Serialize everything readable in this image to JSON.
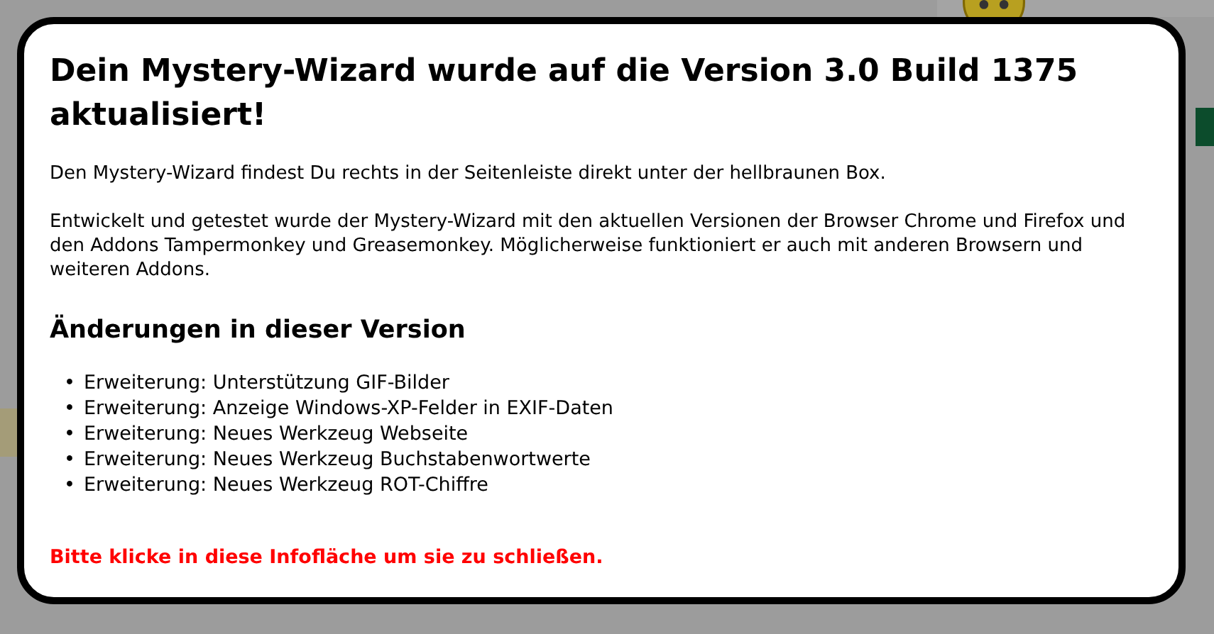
{
  "dialog": {
    "title": "Dein Mystery-Wizard wurde auf die Version 3.0 Build 1375 aktualisiert!",
    "paragraphs": [
      "Den Mystery-Wizard findest Du rechts in der Seitenleiste direkt unter der hellbraunen Box.",
      "Entwickelt und getestet wurde der Mystery-Wizard mit den aktuellen Versionen der Browser Chrome und Firefox und den Addons Tampermonkey und Greasemonkey. Möglicherweise funktioniert er auch mit anderen Browsern und weiteren Addons."
    ],
    "changes_heading": "Änderungen in dieser Version",
    "changes": [
      {
        "marker": "•",
        "text": "Erweiterung: Unterstützung GIF-Bilder"
      },
      {
        "marker": "•",
        "text": "Erweiterung: Anzeige Windows-XP-Felder in EXIF-Daten"
      },
      {
        "marker": "•",
        "text": "Erweiterung: Neues Werkzeug Webseite"
      },
      {
        "marker": "•",
        "text": "Erweiterung: Neues Werkzeug Buchstabenwortwerte"
      },
      {
        "marker": "•",
        "text": "Erweiterung: Neues Werkzeug ROT-Chiffre"
      }
    ],
    "close_hint": "Bitte klicke in diese Infofläche um sie zu schließen."
  }
}
